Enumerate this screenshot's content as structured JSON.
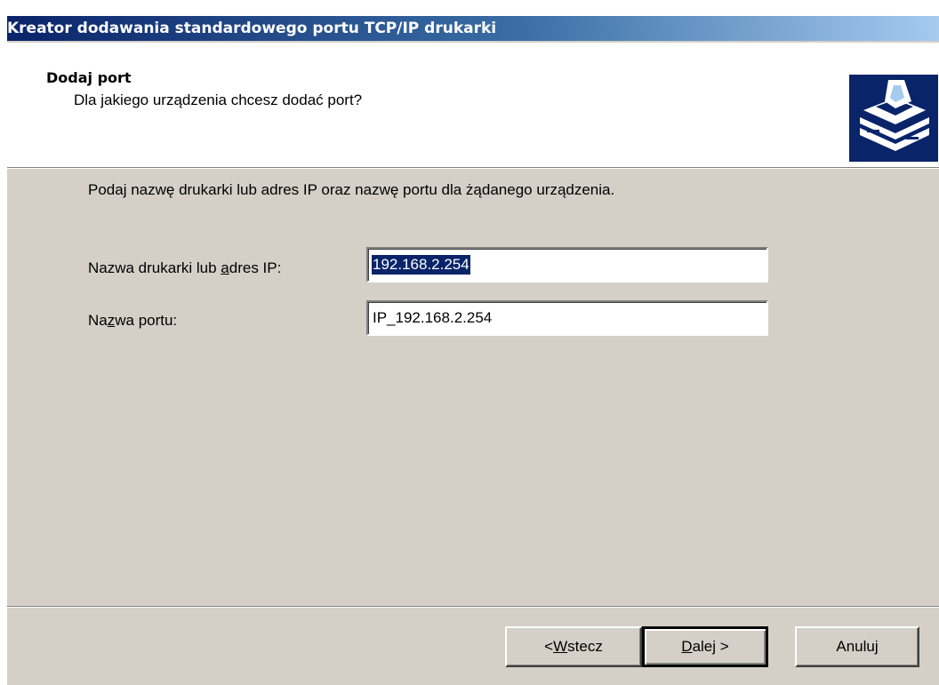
{
  "window": {
    "title": "Kreator dodawania standardowego portu TCP/IP drukarki"
  },
  "header": {
    "title": "Dodaj port",
    "subtitle": "Dla jakiego urządzenia chcesz dodać port?",
    "icon": "printer-wizard-icon"
  },
  "body": {
    "instruction": "Podaj nazwę drukarki lub adres IP oraz nazwę portu dla żądanego urządzenia.",
    "printer_label": {
      "before": "Nazwa drukarki lub ",
      "accel": "a",
      "after": "dres IP:"
    },
    "printer_value": "192.168.2.254",
    "port_label": {
      "before": "Na",
      "accel": "z",
      "after": "wa portu:"
    },
    "port_value": "IP_192.168.2.254"
  },
  "buttons": {
    "back": {
      "before": "< ",
      "accel": "W",
      "after": "stecz"
    },
    "next": {
      "before": "",
      "accel": "D",
      "after": "alej >"
    },
    "cancel": "Anuluj"
  },
  "colors": {
    "title_gradient_start": "#0a246a",
    "title_gradient_end": "#a6caf0",
    "dialog_face": "#d4d0c8",
    "selection": "#0a246a"
  }
}
